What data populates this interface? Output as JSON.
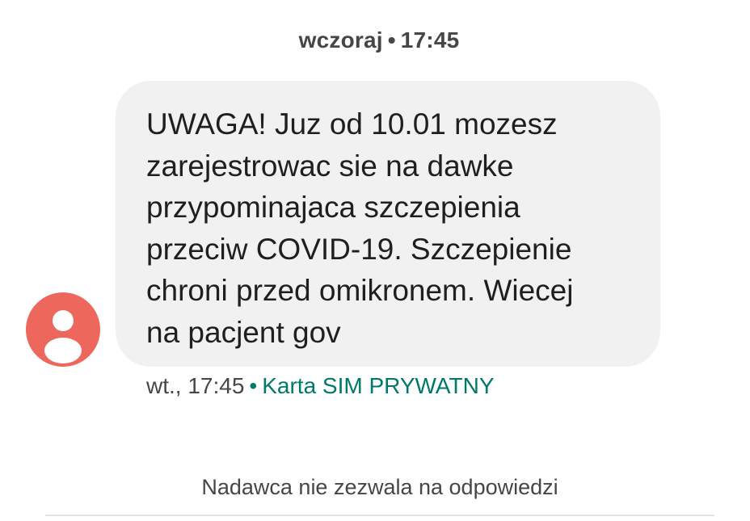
{
  "conversation": {
    "date_header": {
      "day": "wczoraj",
      "separator": "•",
      "time": "17:45"
    },
    "messages": [
      {
        "text": "UWAGA! Juz od 10.01 mozesz\nzarejestrowac sie na dawke\nprzypominajaca szczepienia\nprzeciw COVID-19. Szczepienie\nchroni przed omikronem. Wiecej\nna pacjent gov",
        "timestamp": "wt., 17:45",
        "separator": "•",
        "sim_label": "Karta SIM PRYWATNY",
        "avatar_icon": "person-icon"
      }
    ],
    "reply_status": "Nadawca nie zezwala na odpowiedzi"
  },
  "colors": {
    "avatar_bg": "#ee675c",
    "bubble_bg": "#f1f1f1",
    "sim_label": "#00796b",
    "secondary_text": "#444746",
    "primary_text": "#1f1f1f",
    "divider": "#e3e3e3"
  }
}
